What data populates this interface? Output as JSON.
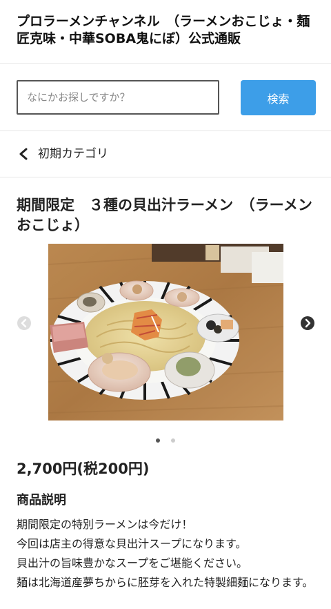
{
  "store": {
    "title": "プロラーメンチャンネル　（ラーメンおこじょ・麺匠克味・中華SOBA鬼にぼ）公式通販"
  },
  "search": {
    "placeholder": "なにかお探しですか？",
    "button_label": "検索"
  },
  "breadcrumb": {
    "category_label": "初期カテゴリ"
  },
  "product": {
    "title": "期間限定　３種の貝出汁ラーメン　（ラーメンおこじょ）",
    "price": "2,700円(税200円)",
    "carousel": {
      "slide_count": 2,
      "active_index": 0
    },
    "description_heading": "商品説明",
    "description_lines": [
      "期間限定の特別ラーメンは今だけ！",
      "今回は店主の得意な貝出汁スープになります。",
      "貝出汁の旨味豊かなスープをご堪能ください。",
      "麺は北海道産夢ちからに胚芽を入れた特製細麺になります。"
    ]
  },
  "colors": {
    "accent": "#3d9ee8",
    "divider": "#e6e6e6"
  }
}
